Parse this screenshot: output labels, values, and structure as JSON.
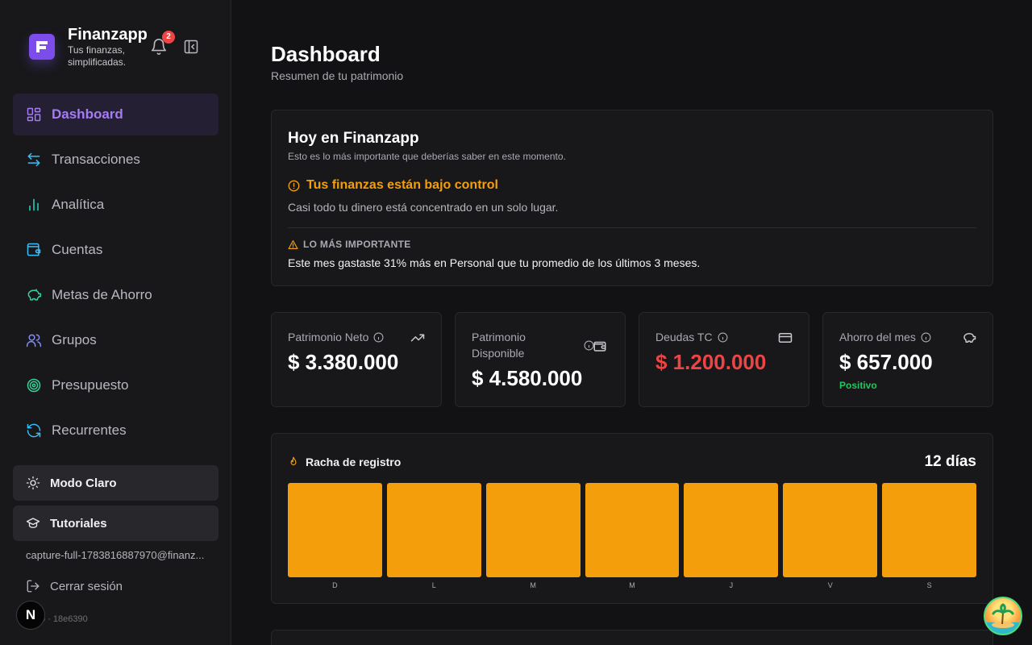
{
  "app": {
    "name": "Finanzapp",
    "tagline": "Tus finanzas, simplificadas.",
    "notifications_count": "2"
  },
  "sidebar": {
    "items": [
      {
        "label": "Dashboard",
        "icon": "dashboard-icon",
        "active": true
      },
      {
        "label": "Transacciones",
        "icon": "arrows-swap-icon"
      },
      {
        "label": "Analítica",
        "icon": "bar-chart-icon"
      },
      {
        "label": "Cuentas",
        "icon": "wallet-icon"
      },
      {
        "label": "Metas de Ahorro",
        "icon": "piggy-bank-icon"
      },
      {
        "label": "Grupos",
        "icon": "users-icon"
      },
      {
        "label": "Presupuesto",
        "icon": "target-icon"
      },
      {
        "label": "Recurrentes",
        "icon": "refresh-icon"
      }
    ],
    "theme_button": "Modo Claro",
    "tutorials_button": "Tutoriales",
    "user_email": "capture-full-1783816887970@finanz...",
    "logout": "Cerrar sesión",
    "version": "0 · 18e6390",
    "dev_badge": "N"
  },
  "header": {
    "title": "Dashboard",
    "subtitle": "Resumen de tu patrimonio"
  },
  "today": {
    "title": "Hoy en Finanzapp",
    "subtitle": "Esto es lo más importante que deberías saber en este momento.",
    "alert_title": "Tus finanzas están bajo control",
    "alert_desc": "Casi todo tu dinero está concentrado en un solo lugar.",
    "important_label": "LO MÁS IMPORTANTE",
    "important_text": "Este mes gastaste 31% más en Personal que tu promedio de los últimos 3 meses."
  },
  "stats": [
    {
      "label": "Patrimonio Neto",
      "value": "$ 3.380.000",
      "icon": "trending-up-icon"
    },
    {
      "label": "Patrimonio Disponible",
      "value": "$ 4.580.000",
      "icon": "wallet-icon"
    },
    {
      "label": "Deudas TC",
      "value": "$ 1.200.000",
      "icon": "credit-card-icon"
    },
    {
      "label": "Ahorro del mes",
      "value": "$ 657.000",
      "icon": "piggy-bank-icon",
      "note": "Positivo"
    }
  ],
  "streak": {
    "title": "Racha de registro",
    "days_count": "12 días",
    "days": [
      "D",
      "L",
      "M",
      "M",
      "J",
      "V",
      "S"
    ]
  },
  "colors": {
    "accent": "#a57cf5",
    "warning": "#f59e0b",
    "danger": "#ef4444",
    "success": "#22c55e"
  }
}
